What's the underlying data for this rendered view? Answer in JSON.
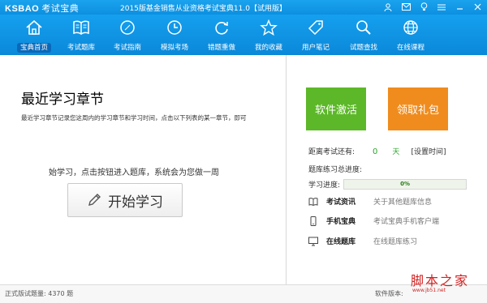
{
  "app": {
    "logo_en": "KSBAO",
    "logo_cn": "考试宝典",
    "title": "2015版基金销售从业资格考试宝典11.0【试用版】"
  },
  "nav": [
    {
      "label": "宝典首页",
      "icon": "home-icon"
    },
    {
      "label": "考试题库",
      "icon": "book-icon"
    },
    {
      "label": "考试指南",
      "icon": "compass-icon"
    },
    {
      "label": "模拟考场",
      "icon": "clock-icon"
    },
    {
      "label": "错题重做",
      "icon": "refresh-icon"
    },
    {
      "label": "我的收藏",
      "icon": "star-icon"
    },
    {
      "label": "用户笔记",
      "icon": "tag-icon"
    },
    {
      "label": "试题查找",
      "icon": "search-icon"
    },
    {
      "label": "在线课程",
      "icon": "globe-icon"
    }
  ],
  "main": {
    "heading": "最近学习章节",
    "description": "最近学习章节记录您这周内的学习章节和学习时间，点击以下列表的某一章节，即可",
    "hint": "始学习，点击按钮进入题库，系统会为您做一周",
    "start_button": "开始学习"
  },
  "side": {
    "activate_button": "软件激活",
    "gift_button": "领取礼包",
    "countdown_label": "距离考试还有:",
    "countdown_value": "0",
    "countdown_unit": "天",
    "set_time": "[设置时间]",
    "progress_title": "题库练习总进度:",
    "progress_label": "学习进度:",
    "progress_value": 0,
    "progress_text": "0%",
    "links": [
      {
        "icon": "book-icon",
        "title": "考试资讯",
        "desc": "关于其他题库信息"
      },
      {
        "icon": "phone-icon",
        "title": "手机宝典",
        "desc": "考试宝典手机客户端"
      },
      {
        "icon": "monitor-icon",
        "title": "在线题库",
        "desc": "在线题库练习"
      }
    ]
  },
  "statusbar": {
    "left": "正式版试题量: 4370 题",
    "right": "软件版本:"
  },
  "watermark": {
    "main": "脚本之家",
    "sub": "www.jb51.net"
  }
}
